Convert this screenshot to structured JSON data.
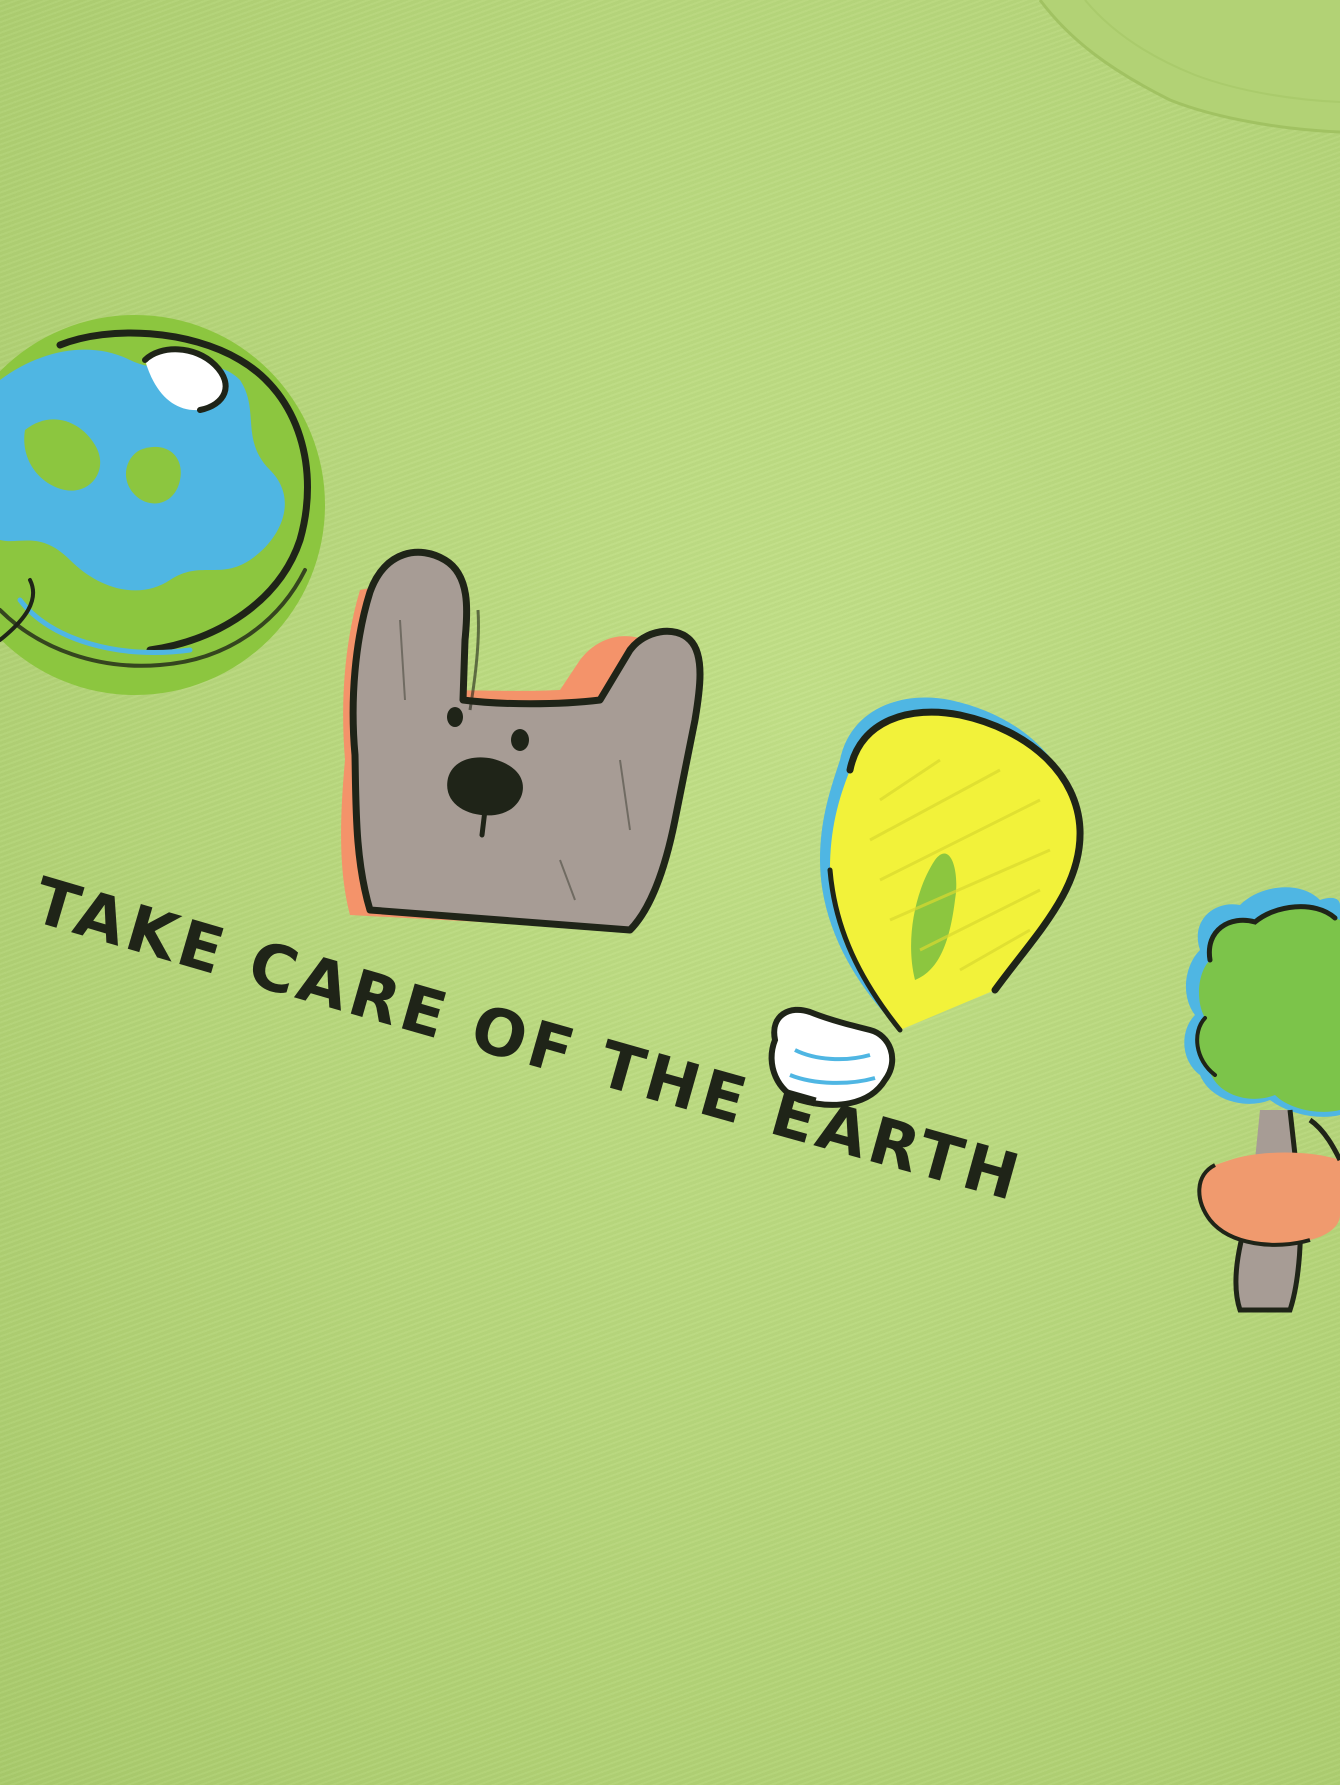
{
  "slogan": "TAKE CARE OF THE EARTH",
  "colors": {
    "fabric": "#b9d97e",
    "ink": "#1f2418",
    "earth_blue": "#4fb6e3",
    "earth_green": "#8cc63f",
    "bag_gray": "#a79c95",
    "bag_orange": "#f4936a",
    "bulb_yellow": "#f2f23a",
    "tree_green": "#7cc44a",
    "tree_orange": "#f09a6e"
  },
  "illustrations": [
    "earth-globe",
    "shopping-bag-face",
    "light-bulb",
    "tree"
  ]
}
